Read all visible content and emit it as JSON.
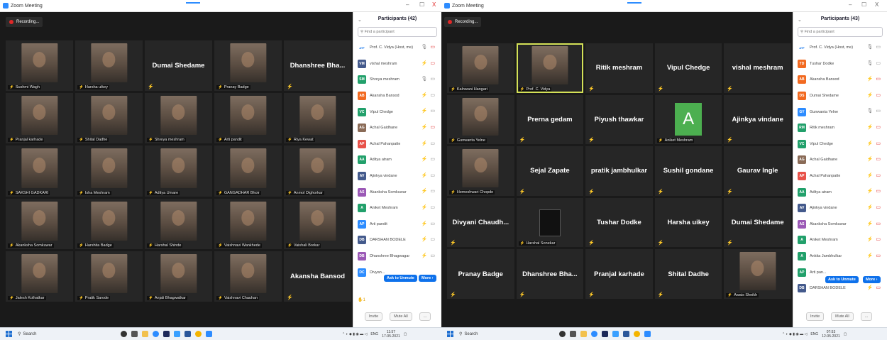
{
  "colors": {
    "accent": "#0e71eb",
    "muted_red": "#e02828",
    "tile_bg": "#262626",
    "speaker_outline": "#d4e157"
  },
  "left": {
    "window_title": "Zoom Meeting",
    "window_controls": {
      "minimize": "–",
      "restore": "☐",
      "close": "X"
    },
    "recording_label": "Recording...",
    "tiles": [
      {
        "type": "video",
        "caption": "Sushmi Wagh"
      },
      {
        "type": "video",
        "caption": "Harsha uikey"
      },
      {
        "type": "name",
        "label": "Dumai Shedame"
      },
      {
        "type": "video",
        "caption": "Pranay Badge"
      },
      {
        "type": "name",
        "label": "Dhanshree Bha..."
      },
      {
        "type": "video",
        "caption": "Pranjal karhade"
      },
      {
        "type": "video",
        "caption": "Shital Dadhe"
      },
      {
        "type": "video",
        "caption": "Shreya meshram"
      },
      {
        "type": "video",
        "caption": "Arti pandit"
      },
      {
        "type": "video",
        "caption": "Riya Kewat"
      },
      {
        "type": "video",
        "caption": "SAKSHI GADKARI"
      },
      {
        "type": "video",
        "caption": "Isha Meshram"
      },
      {
        "type": "video",
        "caption": "Aditya Umare"
      },
      {
        "type": "video",
        "caption": "GANGADHAR Bhoir"
      },
      {
        "type": "video",
        "caption": "Anmol Dighorkar"
      },
      {
        "type": "video",
        "caption": "Akanksha Somkuwar"
      },
      {
        "type": "video",
        "caption": "Harshita Badge"
      },
      {
        "type": "video",
        "caption": "Harshal Shinde"
      },
      {
        "type": "video",
        "caption": "Vaishnavi Wankhede"
      },
      {
        "type": "video",
        "caption": "Vaishali Borkar"
      },
      {
        "type": "video",
        "caption": "Jalesh Kolhatkar"
      },
      {
        "type": "video",
        "caption": "Pratik Sarode"
      },
      {
        "type": "video",
        "caption": "Anjali Bhagwatkar"
      },
      {
        "type": "video",
        "caption": "Vaishnavi Chauhan"
      },
      {
        "type": "name",
        "label": "Akansha Bansod"
      }
    ],
    "panel": {
      "title": "Participants (42)",
      "chevron": "⌄",
      "search_placeholder": "Find a participant",
      "rows": [
        {
          "initials": "ATF",
          "color": "#ffffff",
          "text_color": "#0e71eb",
          "name": "Prof. C. Vidya (Host, me)",
          "mic": "on",
          "video": "off"
        },
        {
          "initials": "VM",
          "color": "#445a8c",
          "name": "vishal meshram",
          "mic": "off",
          "video": "off"
        },
        {
          "initials": "SM",
          "color": "#22a06b",
          "name": "Shreya meshram",
          "mic": "on",
          "video": "on"
        },
        {
          "initials": "AB",
          "color": "#f26a21",
          "name": "Akansha Bansod",
          "mic": "off",
          "video": "on"
        },
        {
          "initials": "VC",
          "color": "#22a06b",
          "name": "Vipul Chedge",
          "mic": "off",
          "video": "on"
        },
        {
          "initials": "AG",
          "color": "#8a6b57",
          "name": "Achal Gaidhane",
          "mic": "off",
          "video": "off"
        },
        {
          "initials": "AP",
          "color": "#e8524a",
          "name": "Achal Pahanpatte",
          "mic": "off",
          "video": "on"
        },
        {
          "initials": "AA",
          "color": "#22a06b",
          "name": "Aditya atram",
          "mic": "off",
          "video": "on"
        },
        {
          "initials": "AV",
          "color": "#445a8c",
          "name": "Ajinkya vindane",
          "mic": "off",
          "video": "on"
        },
        {
          "initials": "AS",
          "color": "#9b59b6",
          "name": "Akanksha Somkuwar",
          "mic": "off",
          "video": "on"
        },
        {
          "initials": "A",
          "color": "#22a06b",
          "name": "Aniket Meshram",
          "mic": "off",
          "video": "on"
        },
        {
          "initials": "AP",
          "color": "#2d8cff",
          "name": "Arti pandit",
          "mic": "off",
          "video": "on"
        },
        {
          "initials": "DB",
          "color": "#445a8c",
          "name": "DARSHAN BODELE",
          "mic": "off",
          "video": "on"
        },
        {
          "initials": "DB",
          "color": "#9b59b6",
          "name": "Dhanshree Bhagwagar",
          "mic": "off",
          "video": "on"
        },
        {
          "initials": "DC",
          "color": "#2d8cff",
          "name": "Divyan...",
          "mic": "",
          "video": ""
        }
      ],
      "ask_to_unmute": "Ask to Unmute",
      "more": "More ›",
      "raised_hand": "✋1",
      "invite": "Invite",
      "mute_all": "Mute All",
      "ellipsis": "..."
    },
    "taskbar": {
      "search": "Search",
      "time": "11:57",
      "date": "17-05-2021",
      "lang": "ENG"
    }
  },
  "right": {
    "window_title": "Zoom Meeting",
    "window_controls": {
      "minimize": "–",
      "restore": "☐",
      "close": "X"
    },
    "recording_label": "Recording...",
    "tiles": [
      {
        "type": "video",
        "caption": "Kalnwani Hangari"
      },
      {
        "type": "video",
        "caption": "Prof. C. Vidya",
        "active": true
      },
      {
        "type": "name",
        "label": "Ritik meshram"
      },
      {
        "type": "name",
        "label": "Vipul Chedge"
      },
      {
        "type": "name",
        "label": "vishal meshram"
      },
      {
        "type": "video",
        "caption": "Gunwanta Yelne"
      },
      {
        "type": "name",
        "label": "Prerna gedam"
      },
      {
        "type": "name",
        "label": "Piyush thawkar"
      },
      {
        "type": "avatar",
        "letter": "A",
        "caption": "Aniket Meshram"
      },
      {
        "type": "name",
        "label": "Ajinkya vindane"
      },
      {
        "type": "video",
        "caption": "Hemeshwari Chopde"
      },
      {
        "type": "name",
        "label": "Sejal Zapate"
      },
      {
        "type": "name",
        "label": "pratik jambhulkar"
      },
      {
        "type": "name",
        "label": "Sushil gondane"
      },
      {
        "type": "name",
        "label": "Gaurav Ingle"
      },
      {
        "type": "name",
        "label": "Divyani Chaudh..."
      },
      {
        "type": "poster",
        "caption": "Harshal Sonekar"
      },
      {
        "type": "name",
        "label": "Tushar Dodke"
      },
      {
        "type": "name",
        "label": "Harsha uikey"
      },
      {
        "type": "name",
        "label": "Dumai Shedame"
      },
      {
        "type": "name",
        "label": "Pranay Badge"
      },
      {
        "type": "name",
        "label": "Dhanshree Bha..."
      },
      {
        "type": "name",
        "label": "Pranjal karhade"
      },
      {
        "type": "name",
        "label": "Shital Dadhe"
      },
      {
        "type": "video",
        "caption": "Awais Sheikh"
      }
    ],
    "panel": {
      "title": "Participants (43)",
      "chevron": "⌄",
      "search_placeholder": "Find a participant",
      "rows": [
        {
          "initials": "ATF",
          "color": "#ffffff",
          "text_color": "#0e71eb",
          "name": "Prof. C. Vidya (Host, me)",
          "mic": "on",
          "video": "on"
        },
        {
          "initials": "TD",
          "color": "#f26a21",
          "name": "Tushar Dodke",
          "mic": "on",
          "video": "on"
        },
        {
          "initials": "AB",
          "color": "#f26a21",
          "name": "Akansha Bansod",
          "mic": "off",
          "video": "off"
        },
        {
          "initials": "DS",
          "color": "#f26a21",
          "name": "Dumai Shedame",
          "mic": "off",
          "video": "off"
        },
        {
          "initials": "GY",
          "color": "#2d8cff",
          "name": "Gunwanta Yelne",
          "mic": "on",
          "video": "on"
        },
        {
          "initials": "RM",
          "color": "#22a06b",
          "name": "Ritik meshram",
          "mic": "off",
          "video": "off"
        },
        {
          "initials": "VC",
          "color": "#22a06b",
          "name": "Vipul Chedge",
          "mic": "off",
          "video": "off"
        },
        {
          "initials": "AG",
          "color": "#8a6b57",
          "name": "Achal Gaidhane",
          "mic": "off",
          "video": "off"
        },
        {
          "initials": "AP",
          "color": "#e8524a",
          "name": "Achal Pahanpatte",
          "mic": "off",
          "video": "off"
        },
        {
          "initials": "AA",
          "color": "#22a06b",
          "name": "Aditya atram",
          "mic": "off",
          "video": "off"
        },
        {
          "initials": "AV",
          "color": "#445a8c",
          "name": "Ajinkya vindane",
          "mic": "off",
          "video": "off"
        },
        {
          "initials": "AS",
          "color": "#9b59b6",
          "name": "Akanksha Somkuwar",
          "mic": "off",
          "video": "off"
        },
        {
          "initials": "A",
          "color": "#22a06b",
          "name": "Aniket Meshram",
          "mic": "off",
          "video": "off"
        },
        {
          "initials": "A",
          "color": "#22a06b",
          "name": "Ankita Jambhulkar",
          "mic": "off",
          "video": "off"
        },
        {
          "initials": "AP",
          "color": "#22a06b",
          "name": "Arti pan...",
          "mic": "",
          "video": ""
        },
        {
          "initials": "DB",
          "color": "#445a8c",
          "name": "DARSHAN BODELE",
          "mic": "off",
          "video": "off"
        }
      ],
      "ask_to_unmute": "Ask to Unmute",
      "more": "More ›",
      "invite": "Invite",
      "mute_all": "Mute All",
      "ellipsis": "..."
    },
    "taskbar": {
      "search": "Search",
      "time": "07:53",
      "date": "12-05-2021",
      "lang": "ENG"
    }
  }
}
